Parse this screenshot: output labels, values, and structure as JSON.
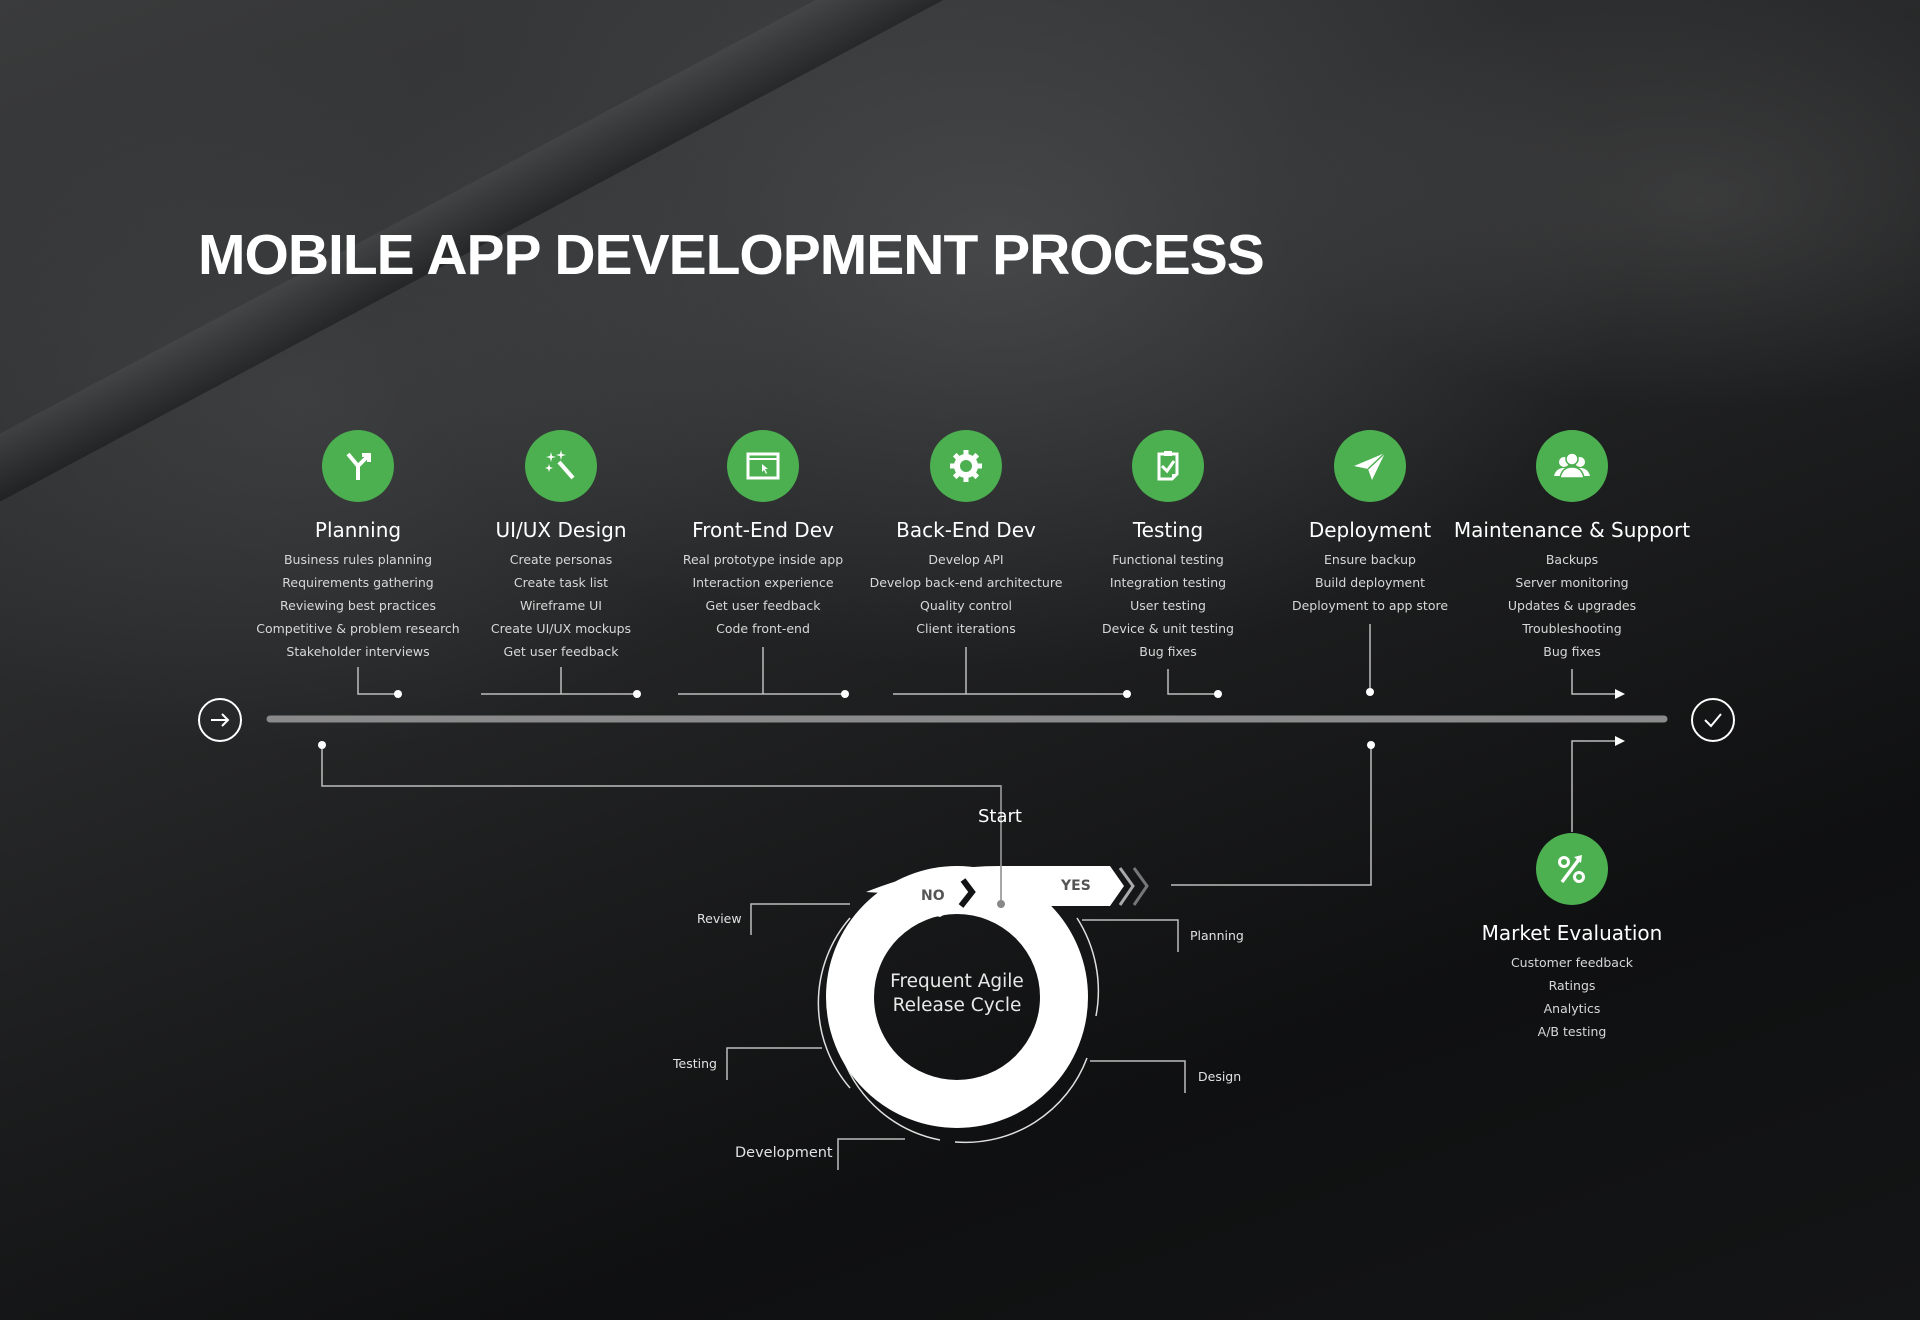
{
  "title": "MOBILE APP DEVELOPMENT PROCESS",
  "colors": {
    "accent": "#4caf50",
    "timeline": "#8a8a8a",
    "text": "#ffffff",
    "subtext": "#d8d8d8"
  },
  "timeline": {
    "start_icon": "arrow-right-circle-icon",
    "end_icon": "check-circle-icon"
  },
  "stages": [
    {
      "icon": "fork-arrow-icon",
      "title": "Planning",
      "items": [
        "Business rules planning",
        "Requirements gathering",
        "Reviewing best practices",
        "Competitive & problem research",
        "Stakeholder interviews"
      ]
    },
    {
      "icon": "magic-wand-icon",
      "title": "UI/UX Design",
      "items": [
        "Create personas",
        "Create task list",
        "Wireframe UI",
        "Create UI/UX mockups",
        "Get user feedback"
      ]
    },
    {
      "icon": "browser-window-icon",
      "title": "Front-End Dev",
      "items": [
        "Real prototype inside app",
        "Interaction experience",
        "Get user feedback",
        "Code front-end"
      ]
    },
    {
      "icon": "gear-icon",
      "title": "Back-End Dev",
      "items": [
        "Develop API",
        "Develop back-end architecture",
        "Quality control",
        "Client iterations"
      ]
    },
    {
      "icon": "clipboard-check-icon",
      "title": "Testing",
      "items": [
        "Functional testing",
        "Integration testing",
        "User testing",
        "Device & unit testing",
        "Bug fixes"
      ]
    },
    {
      "icon": "paper-plane-icon",
      "title": "Deployment",
      "items": [
        "Ensure backup",
        "Build deployment",
        "Deployment to app store"
      ]
    },
    {
      "icon": "users-icon",
      "title": "Maintenance & Support",
      "items": [
        "Backups",
        "Server monitoring",
        "Updates & upgrades",
        "Troubleshooting",
        "Bug fixes"
      ]
    }
  ],
  "market": {
    "icon": "percent-up-icon",
    "title": "Market Evaluation",
    "items": [
      "Customer feedback",
      "Ratings",
      "Analytics",
      "A/B testing"
    ]
  },
  "cycle": {
    "start": "Start",
    "center_line1": "Frequent Agile",
    "center_line2": "Release Cycle",
    "no": "NO",
    "yes": "YES",
    "labels": {
      "review": "Review",
      "planning": "Planning",
      "testing": "Testing",
      "design": "Design",
      "development": "Development"
    }
  }
}
